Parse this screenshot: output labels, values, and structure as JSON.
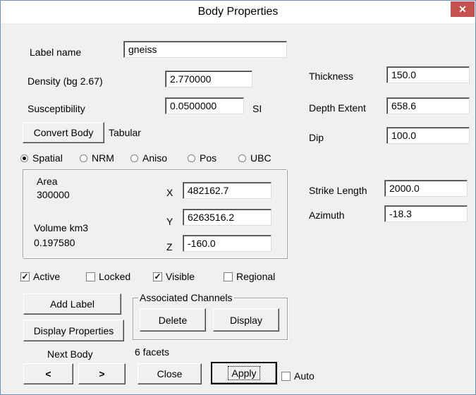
{
  "window": {
    "title": "Body Properties"
  },
  "fields": {
    "label_name": {
      "label": "Label name",
      "value": "gneiss"
    },
    "density": {
      "label": "Density  (bg 2.67)",
      "value": "2.770000"
    },
    "susceptibility": {
      "label": "Susceptibility",
      "value": "0.0500000",
      "unit": "SI"
    },
    "thickness": {
      "label": "Thickness",
      "value": "150.0"
    },
    "depth_extent": {
      "label": "Depth Extent",
      "value": "658.6"
    },
    "dip": {
      "label": "Dip",
      "value": "100.0"
    },
    "strike_length": {
      "label": "Strike Length",
      "value": "2000.0"
    },
    "azimuth": {
      "label": "Azimuth",
      "value": "-18.3"
    }
  },
  "convert": {
    "button": "Convert Body",
    "shape": "Tabular"
  },
  "modes": [
    {
      "label": "Spatial",
      "selected": true
    },
    {
      "label": "NRM",
      "selected": false
    },
    {
      "label": "Aniso",
      "selected": false
    },
    {
      "label": "Pos",
      "selected": false
    },
    {
      "label": "UBC",
      "selected": false
    }
  ],
  "info": {
    "area_label": "Area",
    "area_value": "300000",
    "volume_label": "Volume  km3",
    "volume_value": "0.197580",
    "x_label": "X",
    "x_value": "482162.7",
    "y_label": "Y",
    "y_value": "6263516.2",
    "z_label": "Z",
    "z_value": "-160.0"
  },
  "flags": [
    {
      "label": "Active",
      "checked": true
    },
    {
      "label": "Locked",
      "checked": false
    },
    {
      "label": "Visible",
      "checked": true
    },
    {
      "label": "Regional",
      "checked": false
    }
  ],
  "buttons": {
    "add_label": "Add Label",
    "display_properties": "Display Properties",
    "associated_channels": "Associated Channels",
    "delete": "Delete",
    "display": "Display",
    "next_body": "Next Body",
    "prev": "<",
    "next": ">",
    "facets": "6 facets",
    "close": "Close",
    "apply": "Apply",
    "auto": "Auto"
  },
  "icons": {
    "close": "✕",
    "check": "✓"
  }
}
